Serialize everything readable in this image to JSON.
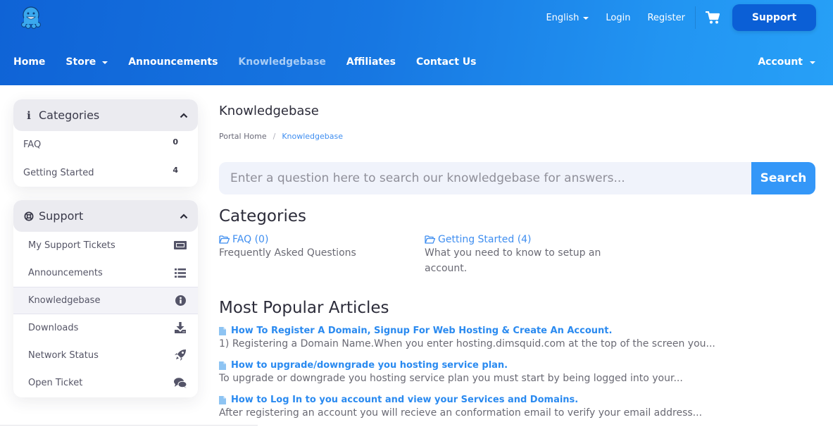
{
  "header": {
    "logo": "squid-mascot-logo",
    "top_links": [
      {
        "label": "English",
        "has_dropdown": true
      },
      {
        "label": "Login"
      },
      {
        "label": "Register"
      }
    ],
    "cart_icon": "shopping-cart-icon",
    "support_button": "Support",
    "nav": [
      {
        "label": "Home"
      },
      {
        "label": "Store",
        "has_dropdown": true
      },
      {
        "label": "Announcements"
      },
      {
        "label": "Knowledgebase",
        "active": true
      },
      {
        "label": "Affiliates"
      },
      {
        "label": "Contact Us"
      }
    ],
    "account": "Account"
  },
  "sidebar": {
    "categories": {
      "title": "Categories",
      "icon": "info-icon",
      "items": [
        {
          "label": "FAQ",
          "count": "0"
        },
        {
          "label": "Getting Started",
          "count": "4"
        }
      ]
    },
    "support": {
      "title": "Support",
      "icon": "life-ring-icon",
      "items": [
        {
          "label": "My Support Tickets",
          "icon": "ticket-icon"
        },
        {
          "label": "Announcements",
          "icon": "list-icon"
        },
        {
          "label": "Knowledgebase",
          "icon": "info-circle-icon",
          "active": true
        },
        {
          "label": "Downloads",
          "icon": "download-icon"
        },
        {
          "label": "Network Status",
          "icon": "rocket-icon"
        },
        {
          "label": "Open Ticket",
          "icon": "comments-icon"
        }
      ]
    }
  },
  "main": {
    "title": "Knowledgebase",
    "breadcrumb": [
      {
        "label": "Portal Home"
      },
      {
        "label": "Knowledgebase",
        "current": true
      }
    ],
    "search": {
      "placeholder": "Enter a question here to search our knowledgebase for answers...",
      "value": "",
      "button": "Search"
    },
    "categories_heading": "Categories",
    "categories": [
      {
        "label": "FAQ (0)",
        "description": "Frequently Asked Questions"
      },
      {
        "label": "Getting Started (4)",
        "description": "What you need to know to setup an account."
      }
    ],
    "popular_heading": "Most Popular Articles",
    "articles": [
      {
        "title": "How To Register A Domain, Signup For Web Hosting & Create An Account.",
        "excerpt": "1) Registering a Domain Name.When you enter hosting.dimsquid.com at the top of the screen you..."
      },
      {
        "title": "How to upgrade/downgrade you hosting service plan.",
        "excerpt": "To upgrade or downgrade you hosting service plan you must start by being logged into your..."
      },
      {
        "title": "How to Log In to you account and view your Services and Domains.",
        "excerpt": "After registering an account you will recieve an conformation email to verify your email address..."
      }
    ]
  },
  "colors": {
    "header_start": "#0f63d6",
    "header_end": "#27a0f7",
    "support_button": "#0b5fd6",
    "link": "#3f8ef0",
    "search_button": "#3497f8"
  }
}
